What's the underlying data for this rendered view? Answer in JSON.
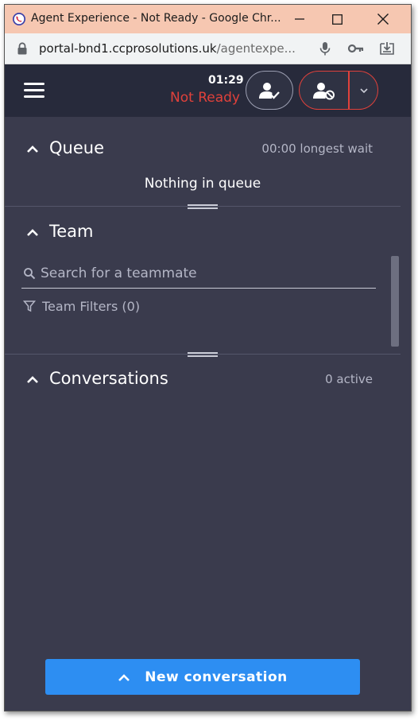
{
  "browser": {
    "window_title": "Agent Experience - Not Ready - Google Chr...",
    "url_host": "portal-bnd1.ccprosolutions.uk",
    "url_path": "/agentexpe..."
  },
  "header": {
    "timer": "01:29",
    "status": "Not Ready",
    "status_color": "#e0413b"
  },
  "queue": {
    "title": "Queue",
    "longest_wait": "00:00 longest wait",
    "empty_message": "Nothing in queue"
  },
  "team": {
    "title": "Team",
    "search_placeholder": "Search for a teammate",
    "filters_label": "Team Filters (0)"
  },
  "conversations": {
    "title": "Conversations",
    "active_count": "0 active"
  },
  "footer": {
    "new_conversation_label": "New conversation",
    "accent_color": "#2d8ef2"
  }
}
